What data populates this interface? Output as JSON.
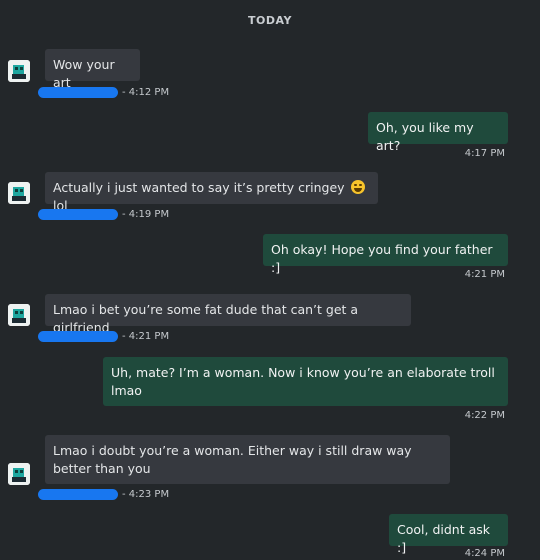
{
  "chat": {
    "day_label": "TODAY",
    "messages": [
      {
        "text": "Wow your art",
        "time": "- 4:12 PM"
      },
      {
        "text": "Oh, you like my art?",
        "time": "4:17 PM"
      },
      {
        "text": "Actually i just wanted to say it’s pretty cringey",
        "text_after_emoji": "lol",
        "emoji": "joy-emoji",
        "time": "- 4:19 PM"
      },
      {
        "text": "Oh okay! Hope you find your father :]",
        "time": "4:21 PM"
      },
      {
        "text": "Lmao i bet you’re some fat dude that can’t get a girlfriend",
        "time": "- 4:21 PM"
      },
      {
        "text": "Uh, mate? I’m a woman. Now i know you’re an elaborate troll lmao",
        "time": "4:22 PM"
      },
      {
        "text": "Lmao i doubt you’re a woman. Either way i still draw way better than you",
        "time": "- 4:23 PM"
      },
      {
        "text": "Cool, didnt ask :]",
        "time": "4:24 PM"
      }
    ]
  },
  "colors": {
    "background": "#23272a",
    "incoming_bubble": "#36393f",
    "outgoing_bubble": "#1f4a3c",
    "redaction": "#1877f0"
  }
}
